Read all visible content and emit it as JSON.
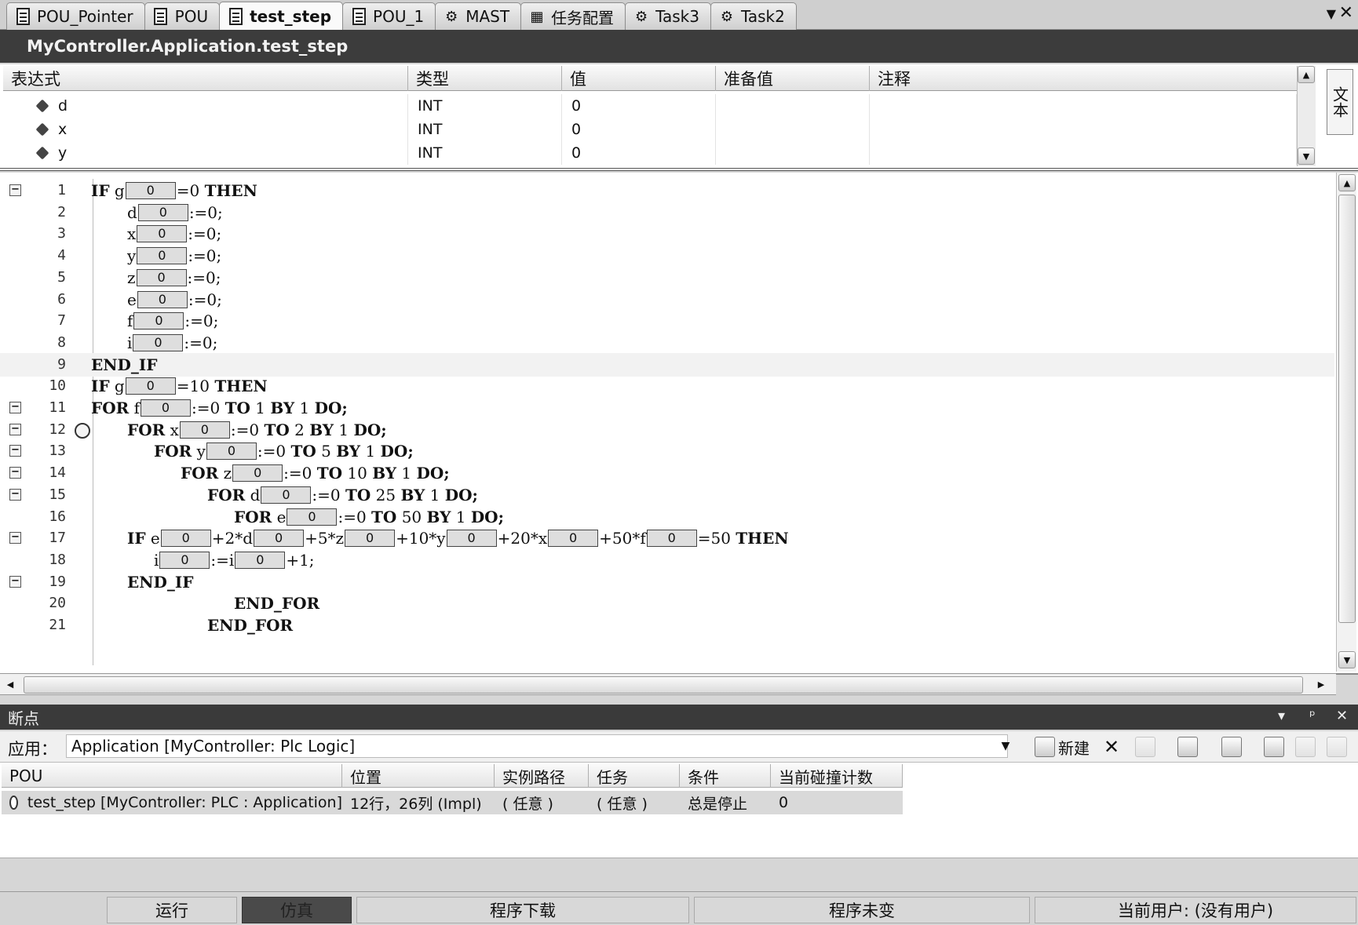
{
  "tabs": [
    {
      "label": "POU_Pointer",
      "icon": "document-icon"
    },
    {
      "label": "POU",
      "icon": "document-icon"
    },
    {
      "label": "test_step",
      "icon": "document-icon",
      "active": true
    },
    {
      "label": "POU_1",
      "icon": "document-icon"
    },
    {
      "label": "MAST",
      "icon": "task-icon"
    },
    {
      "label": "任务配置",
      "icon": "task-config-icon"
    },
    {
      "label": "Task3",
      "icon": "task-icon"
    },
    {
      "label": "Task2",
      "icon": "task-icon"
    }
  ],
  "tab_menu_glyph": "▼",
  "tab_close_glyph": "✕",
  "title": "MyController.Application.test_step",
  "watch": {
    "headers": [
      "表达式",
      "类型",
      "值",
      "准备值",
      "注释"
    ],
    "rows": [
      {
        "expr": "d",
        "type": "INT",
        "value": "0",
        "prepared": "",
        "comment": ""
      },
      {
        "expr": "x",
        "type": "INT",
        "value": "0",
        "prepared": "",
        "comment": ""
      },
      {
        "expr": "y",
        "type": "INT",
        "value": "0",
        "prepared": "",
        "comment": ""
      }
    ],
    "side_label": "文本"
  },
  "code": {
    "lines": [
      {
        "n": "1",
        "fold": true,
        "indent": 0,
        "parts": [
          [
            "k",
            "IF"
          ],
          [
            "t",
            " g"
          ],
          [
            "v",
            "0"
          ],
          [
            "t",
            "=0 "
          ],
          [
            "k",
            "THEN"
          ]
        ]
      },
      {
        "n": "2",
        "indent": 1,
        "parts": [
          [
            "t",
            "d"
          ],
          [
            "v",
            "0"
          ],
          [
            "t",
            ":=0;"
          ]
        ]
      },
      {
        "n": "3",
        "indent": 1,
        "parts": [
          [
            "t",
            "x"
          ],
          [
            "v",
            "0"
          ],
          [
            "t",
            ":=0;"
          ]
        ]
      },
      {
        "n": "4",
        "indent": 1,
        "parts": [
          [
            "t",
            "y"
          ],
          [
            "v",
            "0"
          ],
          [
            "t",
            ":=0;"
          ]
        ]
      },
      {
        "n": "5",
        "indent": 1,
        "parts": [
          [
            "t",
            "z"
          ],
          [
            "v",
            "0"
          ],
          [
            "t",
            ":=0;"
          ]
        ]
      },
      {
        "n": "6",
        "indent": 1,
        "parts": [
          [
            "t",
            "e"
          ],
          [
            "v",
            "0"
          ],
          [
            "t",
            ":=0;"
          ]
        ]
      },
      {
        "n": "7",
        "indent": 1,
        "parts": [
          [
            "t",
            "f"
          ],
          [
            "v",
            "0"
          ],
          [
            "t",
            ":=0;"
          ]
        ]
      },
      {
        "n": "8",
        "indent": 1,
        "parts": [
          [
            "t",
            "i"
          ],
          [
            "v",
            "0"
          ],
          [
            "t",
            ":=0;"
          ]
        ]
      },
      {
        "n": "9",
        "indent": 0,
        "hl": true,
        "parts": [
          [
            "k",
            "END_IF"
          ]
        ]
      },
      {
        "n": "10",
        "indent": 0,
        "parts": [
          [
            "k",
            "IF"
          ],
          [
            "t",
            " g"
          ],
          [
            "v",
            "0"
          ],
          [
            "t",
            "=10 "
          ],
          [
            "k",
            "THEN"
          ]
        ]
      },
      {
        "n": "11",
        "fold": true,
        "indent": 0,
        "parts": [
          [
            "k",
            "FOR"
          ],
          [
            "t",
            " f"
          ],
          [
            "v",
            "0"
          ],
          [
            "t",
            ":=0 "
          ],
          [
            "k",
            "TO"
          ],
          [
            "t",
            " 1 "
          ],
          [
            "k",
            "BY"
          ],
          [
            "t",
            " 1 "
          ],
          [
            "k",
            "DO;"
          ]
        ]
      },
      {
        "n": "12",
        "fold": true,
        "bp": true,
        "indent": 2,
        "parts": [
          [
            "k",
            "FOR"
          ],
          [
            "t",
            " x"
          ],
          [
            "v",
            "0"
          ],
          [
            "t",
            ":=0 "
          ],
          [
            "k",
            "TO"
          ],
          [
            "t",
            " 2 "
          ],
          [
            "k",
            "BY"
          ],
          [
            "t",
            " 1 "
          ],
          [
            "k",
            "DO;"
          ]
        ]
      },
      {
        "n": "13",
        "fold": true,
        "indent": 3,
        "parts": [
          [
            "k",
            "FOR"
          ],
          [
            "t",
            " y"
          ],
          [
            "v",
            "0"
          ],
          [
            "t",
            ":=0 "
          ],
          [
            "k",
            "TO"
          ],
          [
            "t",
            " 5 "
          ],
          [
            "k",
            "BY"
          ],
          [
            "t",
            " 1 "
          ],
          [
            "k",
            "DO;"
          ]
        ]
      },
      {
        "n": "14",
        "fold": true,
        "indent": 4,
        "parts": [
          [
            "k",
            "FOR"
          ],
          [
            "t",
            " z"
          ],
          [
            "v",
            "0"
          ],
          [
            "t",
            ":=0 "
          ],
          [
            "k",
            "TO"
          ],
          [
            "t",
            " 10 "
          ],
          [
            "k",
            "BY"
          ],
          [
            "t",
            " 1 "
          ],
          [
            "k",
            "DO;"
          ]
        ]
      },
      {
        "n": "15",
        "fold": true,
        "indent": 5,
        "parts": [
          [
            "k",
            "FOR"
          ],
          [
            "t",
            " d"
          ],
          [
            "v",
            "0"
          ],
          [
            "t",
            ":=0 "
          ],
          [
            "k",
            "TO"
          ],
          [
            "t",
            " 25 "
          ],
          [
            "k",
            "BY"
          ],
          [
            "t",
            " 1 "
          ],
          [
            "k",
            "DO;"
          ]
        ]
      },
      {
        "n": "16",
        "indent": 6,
        "parts": [
          [
            "k",
            "FOR"
          ],
          [
            "t",
            " e"
          ],
          [
            "v",
            "0"
          ],
          [
            "t",
            ":=0 "
          ],
          [
            "k",
            "TO"
          ],
          [
            "t",
            " 50 "
          ],
          [
            "k",
            "BY"
          ],
          [
            "t",
            " 1 "
          ],
          [
            "k",
            "DO;"
          ]
        ]
      },
      {
        "n": "17",
        "fold": true,
        "indent": 2,
        "parts": [
          [
            "k",
            "IF"
          ],
          [
            "t",
            " e"
          ],
          [
            "v",
            "0"
          ],
          [
            "t",
            "+2*d"
          ],
          [
            "v",
            "0"
          ],
          [
            "t",
            "+5*z"
          ],
          [
            "v",
            "0"
          ],
          [
            "t",
            "+10*y"
          ],
          [
            "v",
            "0"
          ],
          [
            "t",
            "+20*x"
          ],
          [
            "v",
            "0"
          ],
          [
            "t",
            "+50*f"
          ],
          [
            "v",
            "0"
          ],
          [
            "t",
            "=50 "
          ],
          [
            "k",
            "THEN"
          ]
        ]
      },
      {
        "n": "18",
        "indent": 3,
        "parts": [
          [
            "t",
            "i"
          ],
          [
            "v",
            "0"
          ],
          [
            "t",
            ":=i"
          ],
          [
            "v",
            "0"
          ],
          [
            "t",
            "+1;"
          ]
        ]
      },
      {
        "n": "19",
        "fold": true,
        "indent": 2,
        "parts": [
          [
            "k",
            "END_IF"
          ]
        ]
      },
      {
        "n": "20",
        "indent": 6,
        "parts": [
          [
            "k",
            "END_FOR"
          ]
        ]
      },
      {
        "n": "21",
        "indent": 5,
        "parts": [
          [
            "k",
            "END_FOR"
          ]
        ]
      }
    ]
  },
  "breakpoints": {
    "panel_title": "断点",
    "panel_controls": [
      "▾",
      "ᵖ",
      "✕"
    ],
    "app_label": "应用：",
    "app_value": "Application [MyController: Plc Logic]",
    "new_label": "新建",
    "delete_glyph": "✕",
    "headers": [
      "POU",
      "位置",
      "实例路径",
      "任务",
      "条件",
      "当前碰撞计数"
    ],
    "row": {
      "pou": "test_step [MyController: PLC : Application]",
      "position": "12行，26列 (Impl)",
      "instance": "( 任意 )",
      "task": "( 任意 )",
      "condition": "总是停止",
      "hit_count": "0"
    }
  },
  "status": {
    "run": "运行",
    "sim": "仿真",
    "download": "程序下载",
    "unchanged": "程序未变",
    "user": "当前用户: (没有用户)"
  }
}
